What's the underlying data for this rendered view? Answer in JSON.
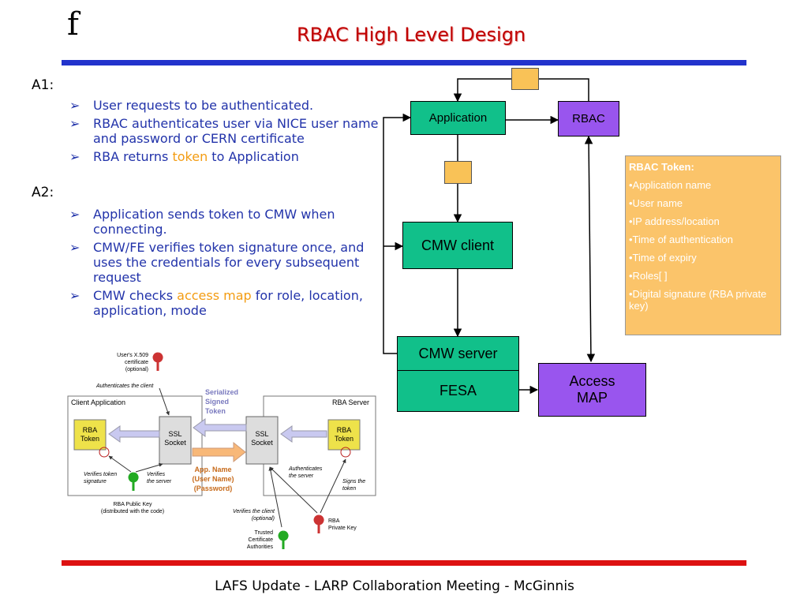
{
  "header": {
    "logo": "f",
    "title": "RBAC High Level Design"
  },
  "footer": {
    "text": "LAFS Update - LARP Collaboration Meeting - McGinnis"
  },
  "sections": [
    {
      "label": "A1:",
      "bullets": [
        [
          "User requests to be authenticated."
        ],
        [
          "RBAC authenticates user via NICE user name and password or CERN certificate"
        ],
        [
          "RBA returns ",
          "token",
          " to Application"
        ]
      ]
    },
    {
      "label": "A2:",
      "bullets": [
        [
          "Application sends token to CMW when connecting."
        ],
        [
          "CMW/FE verifies token signature once, and uses the credentials for every subsequent request"
        ],
        [
          "CMW checks ",
          "access map",
          " for role, location, application, mode"
        ]
      ]
    }
  ],
  "flow": {
    "application": "Application",
    "rbac": "RBAC",
    "cmw_client": "CMW client",
    "cmw_server": "CMW server",
    "fesa": "FESA",
    "access_map": [
      "Access",
      "MAP"
    ]
  },
  "token_info": {
    "heading": "RBAC Token:",
    "items": [
      "•Application name",
      "•User name",
      "•IP address/location",
      "•Time of authentication",
      "•Time of expiry",
      "•Roles[ ]",
      "•Digital signature (RBA private key)"
    ]
  },
  "ssl_diagram": {
    "client_app": "Client Application",
    "rba_server": "RBA Server",
    "ssl_socket": [
      "SSL",
      "Socket"
    ],
    "rba_token": [
      "RBA",
      "Token"
    ],
    "users_cert": [
      "User's X.509",
      "certificate",
      "(optional)"
    ],
    "authenticates_client": "Authenticates the client",
    "serialized_token": [
      "Serialized",
      "Signed",
      "Token"
    ],
    "app_name": [
      "App. Name",
      "(User Name)",
      "(Password)"
    ],
    "verifies_token": [
      "Verifies token",
      "signature"
    ],
    "verifies_server": [
      "Verifies",
      "the server"
    ],
    "authenticates_server": [
      "Authenticates",
      "the server"
    ],
    "signs_token": [
      "Signs the",
      "token"
    ],
    "public_key": [
      "RBA Public Key",
      "(distributed with the code)"
    ],
    "verifies_client": [
      "Verifies the client",
      "(optional)"
    ],
    "trusted_ca": [
      "Trusted",
      "Certificate",
      "Authorities"
    ],
    "private_key": [
      "RBA",
      "Private Key"
    ]
  },
  "colors": {
    "title": "#c00000",
    "blue_bar": "#2233cc",
    "red_bar": "#dd1111",
    "teal": "#11c08a",
    "purple": "#9955ee",
    "token": "#f9c257",
    "bullet_text": "#2233aa",
    "highlight": "#f39c12"
  }
}
